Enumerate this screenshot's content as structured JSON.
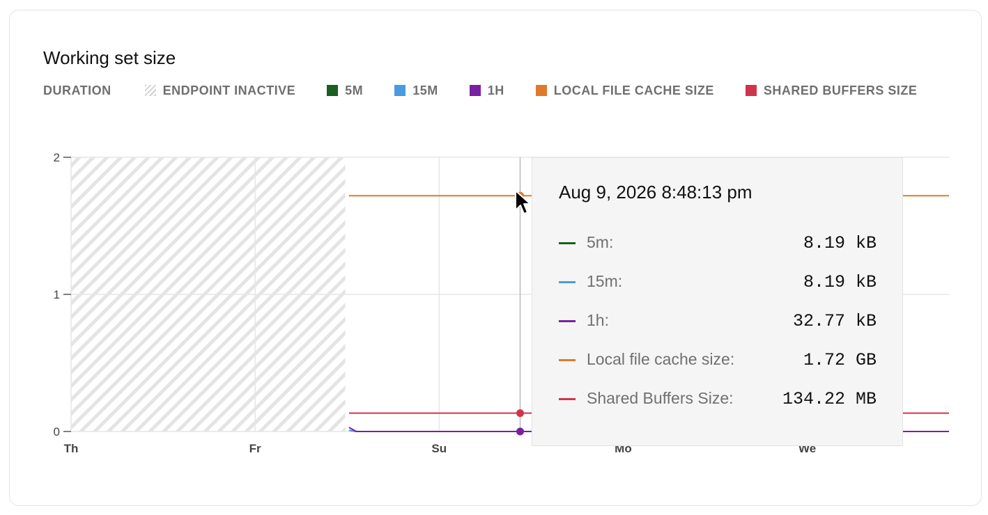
{
  "card": {
    "title": "Working set size"
  },
  "legend": {
    "label": "DURATION",
    "items": [
      {
        "name": "ENDPOINT INACTIVE",
        "swatch": "hatch"
      },
      {
        "name": "5M",
        "color": "#1b5e20"
      },
      {
        "name": "15M",
        "color": "#4a9be0"
      },
      {
        "name": "1H",
        "color": "#7b1fa2"
      },
      {
        "name": "LOCAL FILE CACHE SIZE",
        "color": "#e07a2a"
      },
      {
        "name": "SHARED BUFFERS SIZE",
        "color": "#d0344c"
      }
    ]
  },
  "chart_data": {
    "type": "line",
    "title": "Working set size",
    "xlabel": "",
    "ylabel": "",
    "ylim": [
      0,
      2
    ],
    "yticks": [
      0,
      1,
      2
    ],
    "x_ticks": [
      "Th",
      "Fr",
      "Su",
      "Mo",
      "We"
    ],
    "x_tick_positions_days": [
      0,
      1,
      2,
      3,
      4
    ],
    "xlim_days": [
      0,
      4.77
    ],
    "inactive_range_days": [
      0,
      1.49
    ],
    "grid": true,
    "legend_position": "top",
    "series": [
      {
        "name": "5M",
        "color": "#1b5e20",
        "points": [
          [
            1.51,
            0.008
          ],
          [
            1.55,
            0.0
          ],
          [
            4.77,
            0.0
          ]
        ]
      },
      {
        "name": "15M",
        "color": "#4a9be0",
        "points": [
          [
            1.51,
            0.008
          ],
          [
            1.55,
            0.0
          ],
          [
            4.77,
            0.0
          ]
        ]
      },
      {
        "name": "1H",
        "color": "#7b1fa2",
        "points": [
          [
            1.51,
            0.03
          ],
          [
            1.55,
            0.0
          ],
          [
            4.77,
            0.0
          ]
        ]
      },
      {
        "name": "LOCAL FILE CACHE SIZE",
        "color": "#e07a2a",
        "points": [
          [
            1.51,
            1.72
          ],
          [
            4.77,
            1.72
          ]
        ]
      },
      {
        "name": "SHARED BUFFERS SIZE",
        "color": "#d0344c",
        "points": [
          [
            1.51,
            0.134
          ],
          [
            4.77,
            0.134
          ]
        ]
      }
    ],
    "hover_x_days": 2.44,
    "hover_markers": [
      {
        "series": "LOCAL FILE CACHE SIZE",
        "value": 1.72
      },
      {
        "series": "SHARED BUFFERS SIZE",
        "value": 0.134
      },
      {
        "series": "1H",
        "value": 0.0
      }
    ]
  },
  "tooltip": {
    "timestamp": "Aug 9, 2026 8:48:13 pm",
    "rows": [
      {
        "name": "5m:",
        "value": "8.19 kB",
        "color": "#1b5e20"
      },
      {
        "name": "15m:",
        "value": "8.19 kB",
        "color": "#4a9be0"
      },
      {
        "name": "1h:",
        "value": "32.77 kB",
        "color": "#7b1fa2"
      },
      {
        "name": "Local file cache size:",
        "value": "1.72 GB",
        "color": "#e07a2a"
      },
      {
        "name": "Shared Buffers Size:",
        "value": "134.22 MB",
        "color": "#d0344c"
      }
    ]
  }
}
